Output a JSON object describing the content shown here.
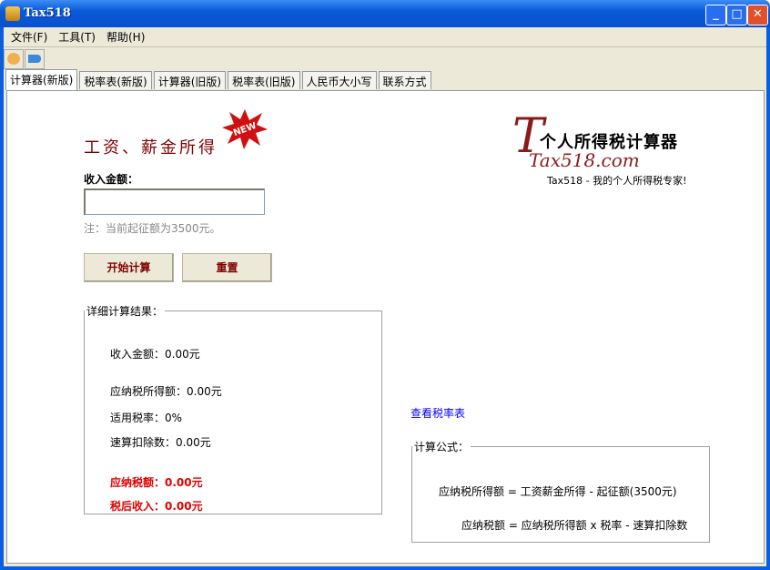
{
  "window": {
    "title": "Tax518",
    "min": "_",
    "max": "□",
    "close": "✕"
  },
  "menu": [
    "文件(F)",
    "工具(T)",
    "帮助(H)"
  ],
  "tabs": [
    "计算器(新版)",
    "税率表(新版)",
    "计算器(旧版)",
    "税率表(旧版)",
    "人民币大小写",
    "联系方式"
  ],
  "main": {
    "heading": "工资、薪金所得",
    "badge": "NEW",
    "income_label": "收入金额：",
    "income_value": "",
    "note": "注：当前起征额为3500元。",
    "calc_button": "开始计算",
    "reset_button": "重置",
    "logo": {
      "title": "个人所得税计算器",
      "brand": "Tax518.com",
      "tagline": "Tax518 - 我的个人所得税专家!"
    },
    "details": {
      "legend": "详细计算结果：",
      "income": "收入金额：0.00元",
      "taxable": "应纳税所得额：0.00元",
      "rate": "适用税率：0%",
      "deduction": "速算扣除数：0.00元",
      "tax": "应纳税额：0.00元",
      "after_tax": "税后收入：0.00元"
    },
    "rate_link": "查看税率表",
    "formula": {
      "legend": "计算公式：",
      "f1": "应纳税所得额 = 工资薪金所得 - 起征额(3500元)",
      "f2": "应纳税额 = 应纳税所得额 x 税率 - 速算扣除数"
    }
  }
}
